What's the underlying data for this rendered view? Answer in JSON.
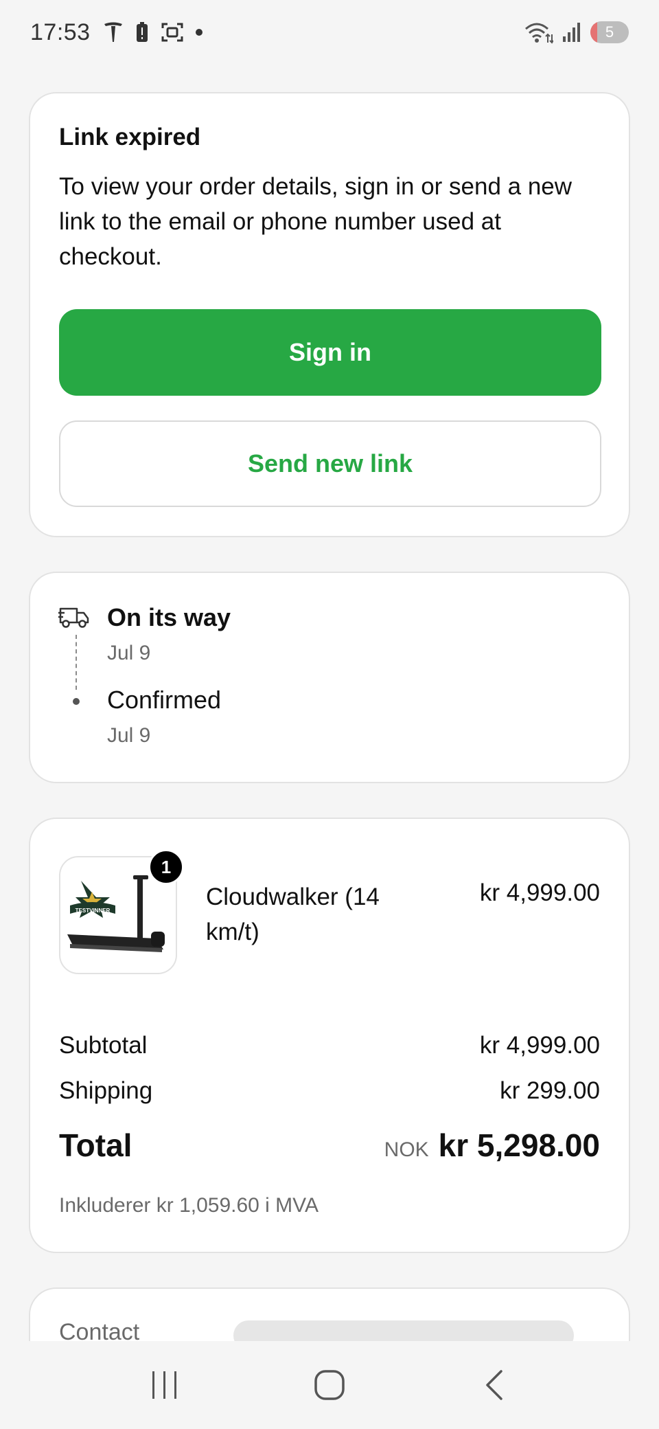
{
  "status_bar": {
    "time": "17:53",
    "battery_level": "5",
    "icons": [
      "tesla-icon",
      "battery-alert-icon",
      "screen-capture-icon",
      "notification-dot-icon",
      "wifi-icon",
      "signal-icon"
    ]
  },
  "link_card": {
    "title": "Link expired",
    "body": "To view your order details, sign in or send a new link to the email or phone number used at checkout.",
    "sign_in_label": "Sign in",
    "send_link_label": "Send new link"
  },
  "status_card": {
    "steps": [
      {
        "title": "On its way",
        "date": "Jul 9",
        "icon": "delivery-truck-icon"
      },
      {
        "title": "Confirmed",
        "date": "Jul 9"
      }
    ]
  },
  "order_card": {
    "item": {
      "name": "Cloudwalker (14 km/t)",
      "price": "kr 4,999.00",
      "quantity": "1",
      "badge_text": "TESTVINNER"
    },
    "subtotal_label": "Subtotal",
    "subtotal_value": "kr 4,999.00",
    "shipping_label": "Shipping",
    "shipping_value": "kr 299.00",
    "total_label": "Total",
    "total_currency": "NOK",
    "total_value": "kr 5,298.00",
    "tax_line": "Inkluderer kr 1,059.60 i MVA"
  },
  "contact_card": {
    "label": "Contact"
  },
  "colors": {
    "accent": "#27a844",
    "background": "#f5f5f5",
    "card": "#ffffff",
    "muted_text": "#6a6a6a"
  }
}
